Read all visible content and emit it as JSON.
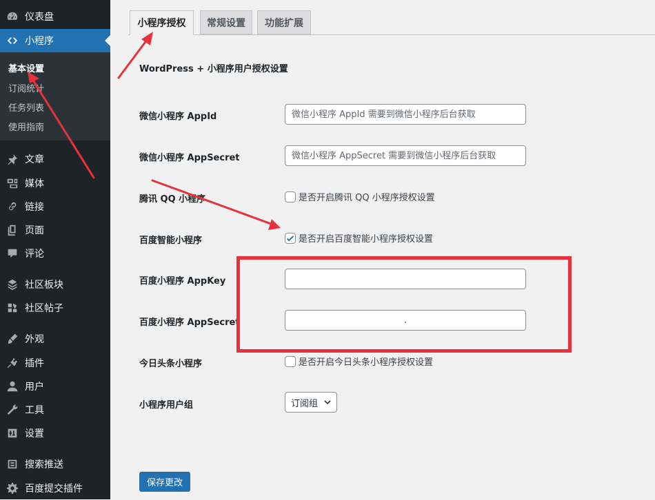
{
  "sidebar": {
    "items": [
      {
        "key": "dashboard",
        "label": "仪表盘",
        "icon": "dashboard-icon"
      },
      {
        "key": "miniprogram",
        "label": "小程序",
        "icon": "code-icon",
        "current": true
      },
      {
        "key": "posts",
        "label": "文章",
        "icon": "pin-icon"
      },
      {
        "key": "media",
        "label": "媒体",
        "icon": "media-icon"
      },
      {
        "key": "links",
        "label": "链接",
        "icon": "link-icon"
      },
      {
        "key": "pages",
        "label": "页面",
        "icon": "page-icon"
      },
      {
        "key": "comments",
        "label": "评论",
        "icon": "comment-icon"
      },
      {
        "key": "forums",
        "label": "社区板块",
        "icon": "forum-icon"
      },
      {
        "key": "topics",
        "label": "社区帖子",
        "icon": "topics-icon"
      },
      {
        "key": "appearance",
        "label": "外观",
        "icon": "brush-icon"
      },
      {
        "key": "plugins",
        "label": "插件",
        "icon": "plugin-icon"
      },
      {
        "key": "users",
        "label": "用户",
        "icon": "user-icon"
      },
      {
        "key": "tools",
        "label": "工具",
        "icon": "wrench-icon"
      },
      {
        "key": "settings",
        "label": "设置",
        "icon": "settings-icon"
      },
      {
        "key": "search_push",
        "label": "搜索推送",
        "icon": "push-icon"
      },
      {
        "key": "baidu_submit",
        "label": "百度提交插件",
        "icon": "gear-icon"
      }
    ],
    "submenu": [
      {
        "label": "基本设置",
        "active": true
      },
      {
        "label": "订阅统计"
      },
      {
        "label": "任务列表"
      },
      {
        "label": "使用指南"
      }
    ]
  },
  "tabs": [
    {
      "label": "小程序授权",
      "active": true
    },
    {
      "label": "常规设置"
    },
    {
      "label": "功能扩展"
    }
  ],
  "page_heading": "WordPress + 小程序用户授权设置",
  "form": {
    "wechat_appid": {
      "label": "微信小程序 AppId",
      "value": "",
      "placeholder": "微信小程序 AppId 需要到微信小程序后台获取"
    },
    "wechat_secret": {
      "label": "微信小程序 AppSecret",
      "value": "",
      "placeholder": "微信小程序 AppSecret 需要到微信小程序后台获取"
    },
    "qq": {
      "label": "腾讯 QQ 小程序",
      "checkbox_label": "是否开启腾讯 QQ 小程序授权设置",
      "checked": false
    },
    "baidu": {
      "label": "百度智能小程序",
      "checkbox_label": "是否开启百度智能小程序授权设置",
      "checked": true
    },
    "baidu_appkey": {
      "label": "百度小程序 AppKey",
      "value": ""
    },
    "baidu_secret": {
      "label": "百度小程序 AppSecret",
      "value": "."
    },
    "toutiao": {
      "label": "今日头条小程序",
      "checkbox_label": "是否开启今日头条小程序授权设置",
      "checked": false
    },
    "user_group": {
      "label": "小程序用户组",
      "selected": "订阅组"
    }
  },
  "save_button": "保存更改",
  "colors": {
    "sidebar_bg": "#1d2327",
    "submenu_bg": "#2c3338",
    "accent": "#2271b1",
    "annotation_red": "#e8323b",
    "content_bg": "#f1f1f1"
  }
}
